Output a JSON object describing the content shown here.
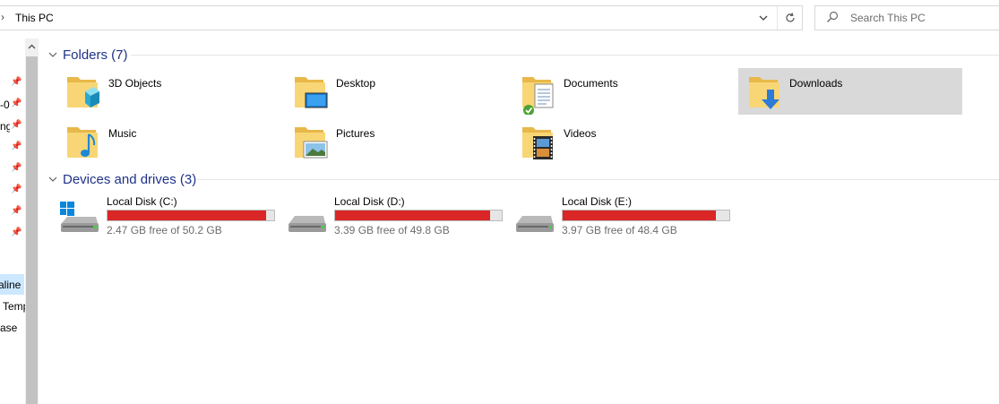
{
  "address": {
    "path": "This PC",
    "search_placeholder": "Search This PC"
  },
  "nav": {
    "fragments": [
      "-0",
      "ng",
      "aline",
      "Temp",
      "ase"
    ]
  },
  "groups": {
    "folders_title": "Folders (7)",
    "drives_title": "Devices and drives (3)"
  },
  "folders": [
    {
      "label": "3D Objects",
      "icon": "3d-objects-icon"
    },
    {
      "label": "Desktop",
      "icon": "desktop-icon"
    },
    {
      "label": "Documents",
      "icon": "documents-icon"
    },
    {
      "label": "Downloads",
      "icon": "downloads-icon"
    },
    {
      "label": "Music",
      "icon": "music-icon"
    },
    {
      "label": "Pictures",
      "icon": "pictures-icon"
    },
    {
      "label": "Videos",
      "icon": "videos-icon"
    }
  ],
  "drives": [
    {
      "name": "Local Disk (C:)",
      "free": "2.47 GB free of 50.2 GB",
      "used_fraction": 0.95
    },
    {
      "name": "Local Disk (D:)",
      "free": "3.39 GB free of 49.8 GB",
      "used_fraction": 0.93
    },
    {
      "name": "Local Disk (E:)",
      "free": "3.97 GB free of 48.4 GB",
      "used_fraction": 0.92
    }
  ],
  "colors": {
    "accent_text": "#1e3287",
    "bar_fill": "#da2626",
    "selected_bg": "#d9d9d9"
  }
}
